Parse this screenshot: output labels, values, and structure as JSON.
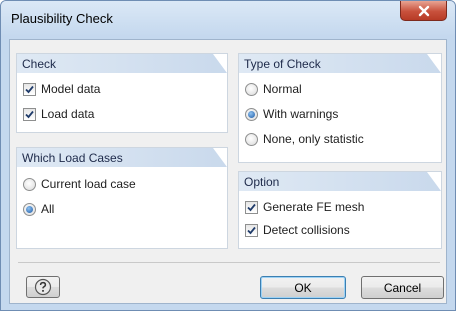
{
  "window": {
    "title": "Plausibility Check"
  },
  "groups": {
    "check": {
      "title": "Check",
      "items": [
        {
          "label": "Model data",
          "checked": true
        },
        {
          "label": "Load data",
          "checked": true
        }
      ]
    },
    "type_of_check": {
      "title": "Type of Check",
      "options": [
        {
          "label": "Normal",
          "selected": false
        },
        {
          "label": "With warnings",
          "selected": true
        },
        {
          "label": "None, only statistic",
          "selected": false
        }
      ]
    },
    "which_load_cases": {
      "title": "Which Load Cases",
      "options": [
        {
          "label": "Current load case",
          "selected": false
        },
        {
          "label": "All",
          "selected": true
        }
      ]
    },
    "option": {
      "title": "Option",
      "items": [
        {
          "label": "Generate FE mesh",
          "checked": true
        },
        {
          "label": "Detect collisions",
          "checked": true
        }
      ]
    }
  },
  "buttons": {
    "ok": "OK",
    "cancel": "Cancel"
  },
  "icons": {
    "close": "close-icon",
    "help": "help-icon",
    "check": "check-mark-icon"
  },
  "colors": {
    "accent": "#1d5aa6",
    "header": "#c9d9ec",
    "close": "#c8513c"
  }
}
